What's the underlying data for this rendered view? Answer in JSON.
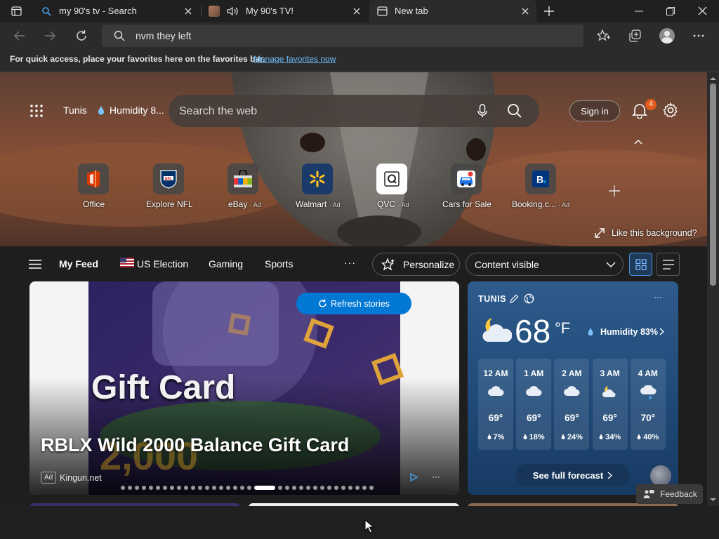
{
  "tabs": [
    {
      "title": "my 90's tv - Search"
    },
    {
      "title": "My 90's TV!"
    },
    {
      "title": "New tab"
    }
  ],
  "address_bar": {
    "value": "nvm they left"
  },
  "favorites_bar": {
    "message": "For quick access, place your favorites here on the favorites bar.",
    "link": "Manage favorites now"
  },
  "hero": {
    "location": "Tunis",
    "humidity": "Humidity 8...",
    "search_placeholder": "Search the web",
    "sign_in": "Sign in",
    "notification_count": "4",
    "like_background": "Like this background?",
    "shortcuts": [
      {
        "label": "Office",
        "ad": ""
      },
      {
        "label": "Explore NFL",
        "ad": ""
      },
      {
        "label": "eBay",
        "ad": "· Ad"
      },
      {
        "label": "Walmart",
        "ad": "· Ad"
      },
      {
        "label": "QVC",
        "ad": "· Ad"
      },
      {
        "label": "Cars for Sale",
        "ad": ""
      },
      {
        "label": "Booking.c...",
        "ad": "· Ad"
      }
    ]
  },
  "feed_nav": {
    "items": [
      "My Feed",
      "US Election",
      "Gaming",
      "Sports"
    ],
    "more": "···",
    "personalize": "Personalize",
    "content_visible": "Content visible"
  },
  "story": {
    "refresh": "Refresh stories",
    "image_text_1": "Gift Card",
    "image_text_2": "2,000",
    "title": "RBLX Wild 2000 Balance Gift Card",
    "ad_badge": "Ad",
    "source": "Kingun.net",
    "more": "···",
    "carousel_dots": 34,
    "carousel_active": 19
  },
  "weather": {
    "city": "TUNIS",
    "temp": "68",
    "unit": "°F",
    "humidity": "Humidity 83%",
    "more": "···",
    "forecast": [
      {
        "time": "12 AM",
        "temp": "69°",
        "precip": "7%",
        "icon": "cloud-icon"
      },
      {
        "time": "1 AM",
        "temp": "69°",
        "precip": "18%",
        "icon": "cloud-icon"
      },
      {
        "time": "2 AM",
        "temp": "69°",
        "precip": "24%",
        "icon": "cloud-icon"
      },
      {
        "time": "3 AM",
        "temp": "69°",
        "precip": "34%",
        "icon": "partly-cloudy-night-icon"
      },
      {
        "time": "4 AM",
        "temp": "70°",
        "precip": "40%",
        "icon": "rain-cloud-icon"
      }
    ],
    "see_full": "See full forecast"
  },
  "feedback": "Feedback",
  "colors": {
    "accent": "#0078d4",
    "link": "#6cb8f6",
    "badge": "#e25a1c"
  }
}
